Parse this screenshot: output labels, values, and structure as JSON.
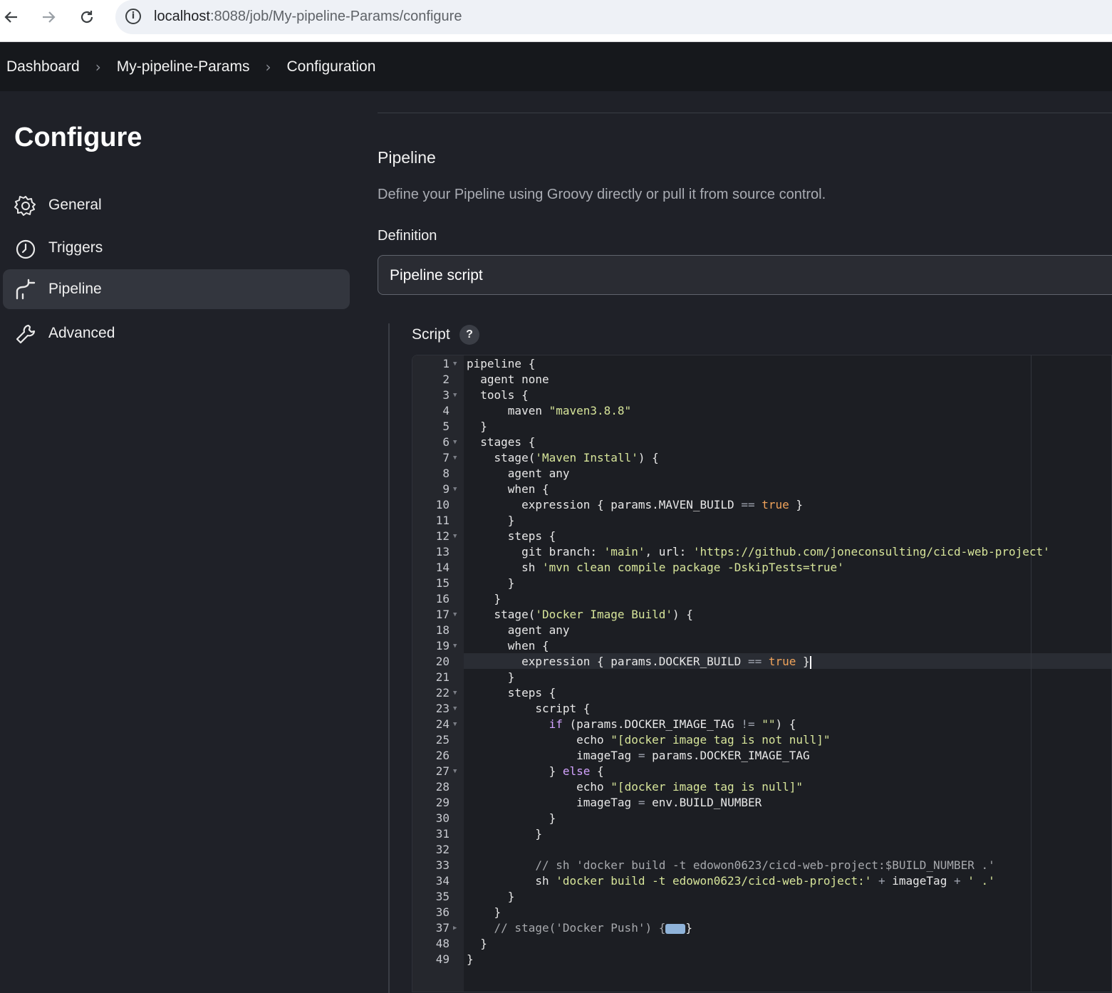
{
  "browser": {
    "url_host": "localhost",
    "url_rest": ":8088/job/My-pipeline-Params/configure",
    "back_icon": "arrow-left-icon",
    "forward_icon": "arrow-right-icon",
    "reload_icon": "reload-icon"
  },
  "breadcrumb": [
    "Dashboard",
    "My-pipeline-Params",
    "Configuration"
  ],
  "sidebar": {
    "title": "Configure",
    "items": [
      {
        "label": "General",
        "icon": "gear-icon",
        "active": false
      },
      {
        "label": "Triggers",
        "icon": "clock-icon",
        "active": false
      },
      {
        "label": "Pipeline",
        "icon": "pipeline-icon",
        "active": true
      },
      {
        "label": "Advanced",
        "icon": "wrench-icon",
        "active": false
      }
    ]
  },
  "main": {
    "section_title": "Pipeline",
    "section_desc": "Define your Pipeline using Groovy directly or pull it from source control.",
    "definition_label": "Definition",
    "definition_value": "Pipeline script",
    "script_label": "Script",
    "help": "?"
  },
  "editor": {
    "lines": [
      {
        "n": "1",
        "fold": true,
        "code": "pipeline {"
      },
      {
        "n": "2",
        "fold": false,
        "code": "  agent none"
      },
      {
        "n": "3",
        "fold": true,
        "code": "  tools {"
      },
      {
        "n": "4",
        "fold": false,
        "code": "      maven \"maven3.8.8\""
      },
      {
        "n": "5",
        "fold": false,
        "code": "  }"
      },
      {
        "n": "6",
        "fold": true,
        "code": "  stages {"
      },
      {
        "n": "7",
        "fold": true,
        "code": "    stage('Maven Install') {"
      },
      {
        "n": "8",
        "fold": false,
        "code": "      agent any"
      },
      {
        "n": "9",
        "fold": true,
        "code": "      when {"
      },
      {
        "n": "10",
        "fold": false,
        "code": "        expression { params.MAVEN_BUILD == true }"
      },
      {
        "n": "11",
        "fold": false,
        "code": "      }"
      },
      {
        "n": "12",
        "fold": true,
        "code": "      steps {"
      },
      {
        "n": "13",
        "fold": false,
        "code": "        git branch: 'main', url: 'https://github.com/joneconsulting/cicd-web-project'"
      },
      {
        "n": "14",
        "fold": false,
        "code": "        sh 'mvn clean compile package -DskipTests=true'"
      },
      {
        "n": "15",
        "fold": false,
        "code": "      }"
      },
      {
        "n": "16",
        "fold": false,
        "code": "    }"
      },
      {
        "n": "17",
        "fold": true,
        "code": "    stage('Docker Image Build') {"
      },
      {
        "n": "18",
        "fold": false,
        "code": "      agent any"
      },
      {
        "n": "19",
        "fold": true,
        "code": "      when {"
      },
      {
        "n": "20",
        "fold": false,
        "code": "        expression { params.DOCKER_BUILD == true }"
      },
      {
        "n": "21",
        "fold": false,
        "code": "      }"
      },
      {
        "n": "22",
        "fold": true,
        "code": "      steps {"
      },
      {
        "n": "23",
        "fold": true,
        "code": "          script {"
      },
      {
        "n": "24",
        "fold": true,
        "code": "            if (params.DOCKER_IMAGE_TAG != \"\") {"
      },
      {
        "n": "25",
        "fold": false,
        "code": "                echo \"[docker image tag is not null]\""
      },
      {
        "n": "26",
        "fold": false,
        "code": "                imageTag = params.DOCKER_IMAGE_TAG"
      },
      {
        "n": "27",
        "fold": true,
        "code": "            } else {"
      },
      {
        "n": "28",
        "fold": false,
        "code": "                echo \"[docker image tag is null]\""
      },
      {
        "n": "29",
        "fold": false,
        "code": "                imageTag = env.BUILD_NUMBER"
      },
      {
        "n": "30",
        "fold": false,
        "code": "            }"
      },
      {
        "n": "31",
        "fold": false,
        "code": "          }"
      },
      {
        "n": "32",
        "fold": false,
        "code": ""
      },
      {
        "n": "33",
        "fold": false,
        "code": "          // sh 'docker build -t edowon0623/cicd-web-project:$BUILD_NUMBER .'"
      },
      {
        "n": "34",
        "fold": false,
        "code": "          sh 'docker build -t edowon0623/cicd-web-project:' + imageTag + ' .'"
      },
      {
        "n": "35",
        "fold": false,
        "code": "      }"
      },
      {
        "n": "36",
        "fold": false,
        "code": "    }"
      },
      {
        "n": "37",
        "fold": "collapsed",
        "code": "    // stage('Docker Push') {"
      },
      {
        "n": "48",
        "fold": false,
        "code": "  }"
      },
      {
        "n": "49",
        "fold": false,
        "code": "}"
      }
    ]
  },
  "colors": {
    "string": "#d7e59a",
    "boolean": "#f0a35b",
    "keyword": "#d3a3ff",
    "comment": "#a7a9ad",
    "active_nav_bg": "#33363e"
  }
}
